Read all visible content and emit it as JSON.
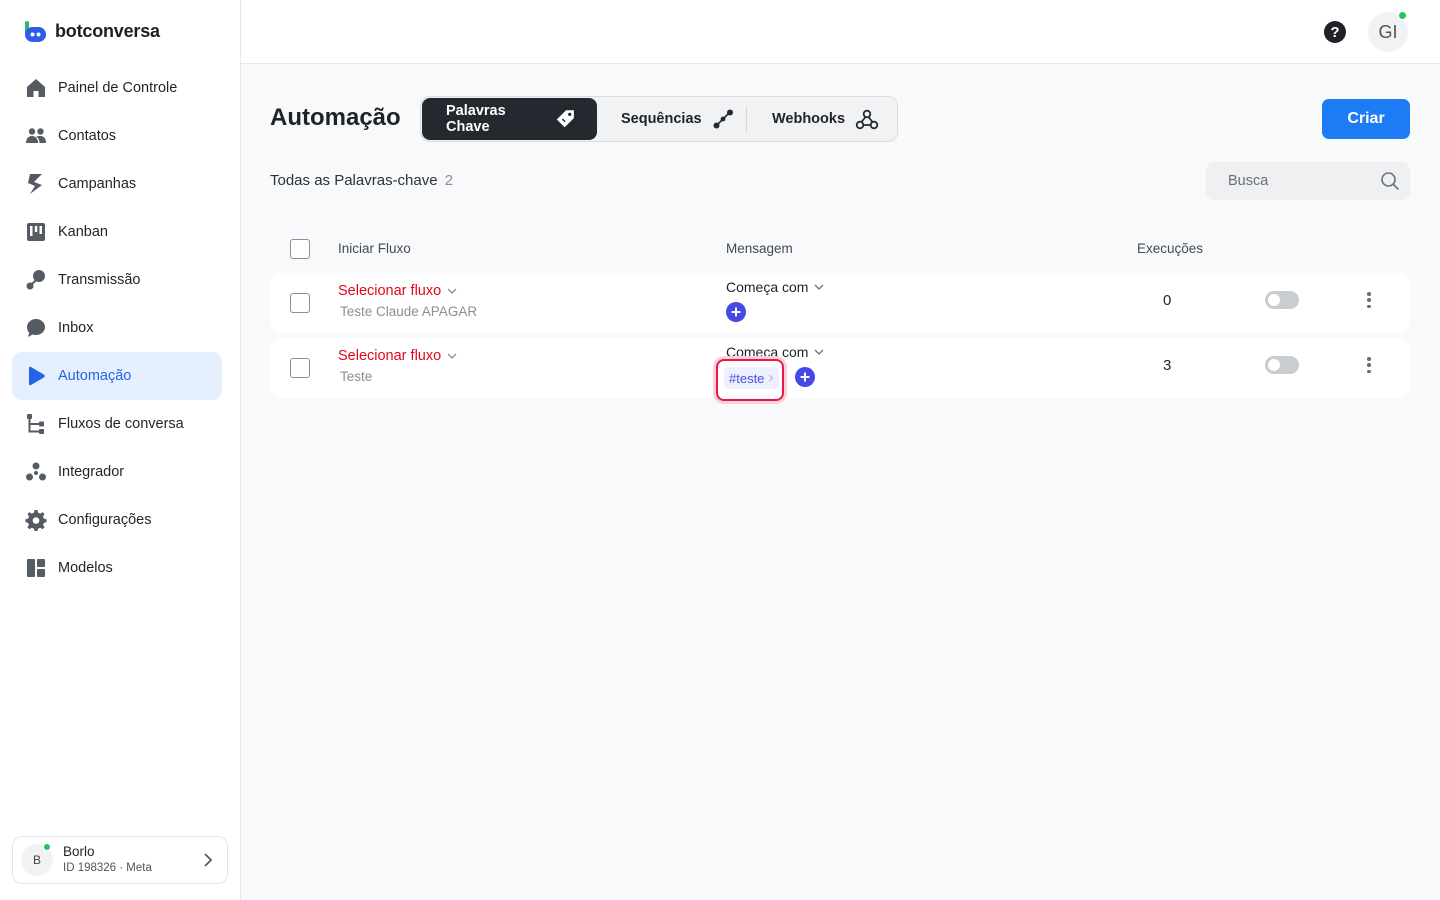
{
  "brand": {
    "name": "botconversa"
  },
  "sidebar": {
    "items": [
      {
        "label": "Painel de Controle",
        "icon": "home-icon"
      },
      {
        "label": "Contatos",
        "icon": "users-icon"
      },
      {
        "label": "Campanhas",
        "icon": "bolt-icon"
      },
      {
        "label": "Kanban",
        "icon": "kanban-icon"
      },
      {
        "label": "Transmissão",
        "icon": "broadcast-icon"
      },
      {
        "label": "Inbox",
        "icon": "chat-icon"
      },
      {
        "label": "Automação",
        "icon": "play-icon",
        "active": true
      },
      {
        "label": "Fluxos de conversa",
        "icon": "flow-icon"
      },
      {
        "label": "Integrador",
        "icon": "integrations-icon"
      },
      {
        "label": "Configurações",
        "icon": "gear-icon"
      },
      {
        "label": "Modelos",
        "icon": "templates-icon"
      }
    ],
    "account": {
      "initial": "B",
      "name": "Borlo",
      "id": "ID 198326 · Meta"
    }
  },
  "topbar": {
    "help": "?",
    "user_initials": "GI"
  },
  "page": {
    "title": "Automação",
    "tabs": [
      {
        "label": "Palavras Chave",
        "icon": "tag-icon",
        "active": true
      },
      {
        "label": "Sequências",
        "icon": "sequence-icon"
      },
      {
        "label": "Webhooks",
        "icon": "webhook-icon"
      }
    ],
    "create_label": "Criar",
    "count_label": "Todas as Palavras-chave",
    "count": "2",
    "search_placeholder": "Busca"
  },
  "table": {
    "headers": {
      "flow": "Iniciar Fluxo",
      "message": "Mensagem",
      "executions": "Execuções"
    },
    "rows": [
      {
        "flow_select": "Selecionar fluxo",
        "flow_name": "Teste Claude APAGAR",
        "condition": "Começa com",
        "keywords": [],
        "executions": "0",
        "enabled": false
      },
      {
        "flow_select": "Selecionar fluxo",
        "flow_name": "Teste",
        "condition": "Começa com",
        "keywords": [
          "#teste"
        ],
        "executions": "3",
        "enabled": false
      }
    ]
  },
  "colors": {
    "accent": "#1d7bf5",
    "active_nav": "#e6effd",
    "danger_text": "#e3061b",
    "plus": "#4548e6",
    "highlight": "#e8194a"
  }
}
